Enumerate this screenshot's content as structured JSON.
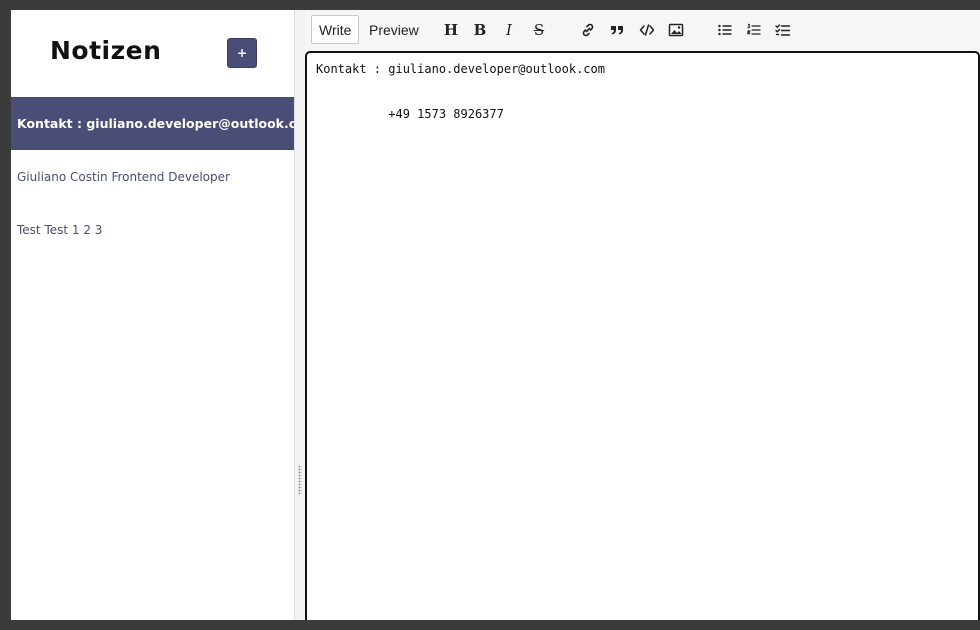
{
  "sidebar": {
    "title": "Notizen",
    "add_label": "+",
    "notes": [
      {
        "label": "Kontakt : giuliano.developer@outlook.com",
        "active": true
      },
      {
        "label": "Giuliano Costin Frontend Developer",
        "active": false
      },
      {
        "label": "Test Test 1 2 3",
        "active": false
      }
    ]
  },
  "editor": {
    "tabs": [
      "Write",
      "Preview"
    ],
    "active_tab": "Write",
    "toolbar_icons": [
      "heading-icon",
      "bold-icon",
      "italic-icon",
      "strikethrough-icon",
      "link-icon",
      "quote-icon",
      "code-icon",
      "image-icon",
      "unordered-list-icon",
      "ordered-list-icon",
      "checklist-icon"
    ],
    "heading_glyph": "H",
    "bold_glyph": "B",
    "italic_glyph": "I",
    "strike_glyph": "S",
    "content": "Kontakt : giuliano.developer@outlook.com\n\n\n          +49 1573 8926377"
  },
  "colors": {
    "accent": "#4a4e76",
    "background": "#3b3b3b"
  }
}
